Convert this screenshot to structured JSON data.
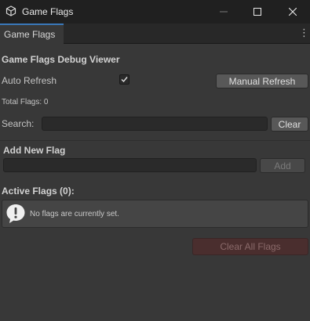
{
  "window": {
    "title": "Game Flags"
  },
  "tab": {
    "label": "Game Flags"
  },
  "panel": {
    "heading": "Game Flags Debug Viewer",
    "auto_refresh_label": "Auto Refresh",
    "auto_refresh_checked": true,
    "manual_refresh_label": "Manual Refresh",
    "total_flags_text": "Total Flags: 0",
    "search_label": "Search:",
    "search_value": "",
    "clear_label": "Clear",
    "add_section_title": "Add New Flag",
    "new_flag_value": "",
    "add_label": "Add",
    "active_flags_title": "Active Flags (0):",
    "empty_message": "No flags are currently set.",
    "clear_all_label": "Clear All Flags"
  },
  "colors": {
    "background": "#383838",
    "tab_accent": "#3a79bb",
    "danger_disabled": "#4a2e2e"
  }
}
